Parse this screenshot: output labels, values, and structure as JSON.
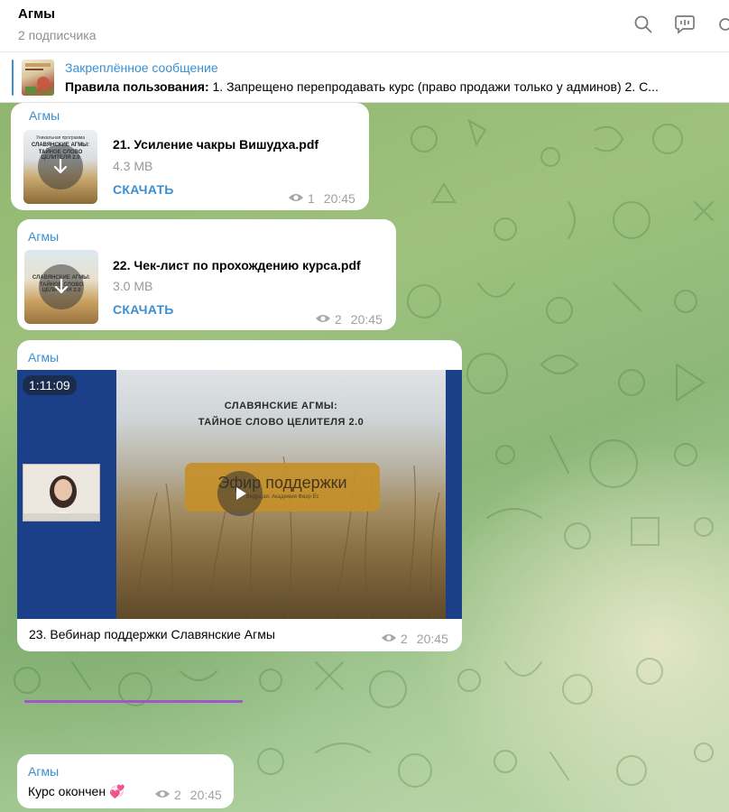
{
  "header": {
    "title": "Агмы",
    "subtitle": "2 подписчика"
  },
  "pinned": {
    "title": "Закреплённое сообщение",
    "bold_prefix": "Правила пользования:",
    "text": " 1. Запрещено перепродавать курс (право продажи только у админов) 2. С..."
  },
  "messages": {
    "file1": {
      "sender": "Агмы",
      "thumb_line1": "Уникальная программа",
      "thumb_line2": "СЛАВЯНСКИЕ АГМЫ:",
      "thumb_line3": "ТАЙНОЕ СЛОВО ЦЕЛИТЕЛЯ 2.0",
      "name": "21. Усиление чакры Вишудха.pdf",
      "size": "4.3 MB",
      "download": "СКАЧАТЬ",
      "views": "1",
      "time": "20:45"
    },
    "file2": {
      "sender": "Агмы",
      "thumb_line1": "СЛАВЯНСКИЕ АГМЫ:",
      "thumb_line2": "ТАЙНОЕ СЛОВО ЦЕЛИТЕЛЯ 2.0",
      "name": "22. Чек-лист по прохождению курса.pdf",
      "size": "3.0 MB",
      "download": "СКАЧАТЬ",
      "views": "2",
      "time": "20:45"
    },
    "video": {
      "sender": "Агмы",
      "duration": "1:11:09",
      "title_line1": "СЛАВЯНСКИЕ АГМЫ:",
      "title_line2": "ТАЙНОЕ СЛОВО ЦЕЛИТЕЛЯ 2.0",
      "button_text": "Эфир поддержки",
      "button_sub": "Ведущая: Академия Фаэр Ес",
      "caption": "23. Вебинар поддержки Славянские Агмы",
      "views": "2",
      "time": "20:45"
    },
    "final": {
      "sender": "Агмы",
      "text": "Курс окончен 💞",
      "views": "2",
      "time": "20:45"
    }
  },
  "icons": [
    "search-icon",
    "chat-bubble-icon",
    "more-icon",
    "download-icon",
    "play-icon",
    "eye-icon"
  ],
  "colors": {
    "accent": "#3a8fd0",
    "meta": "#a0a0a0",
    "divider_purple": "#9c58c8"
  }
}
